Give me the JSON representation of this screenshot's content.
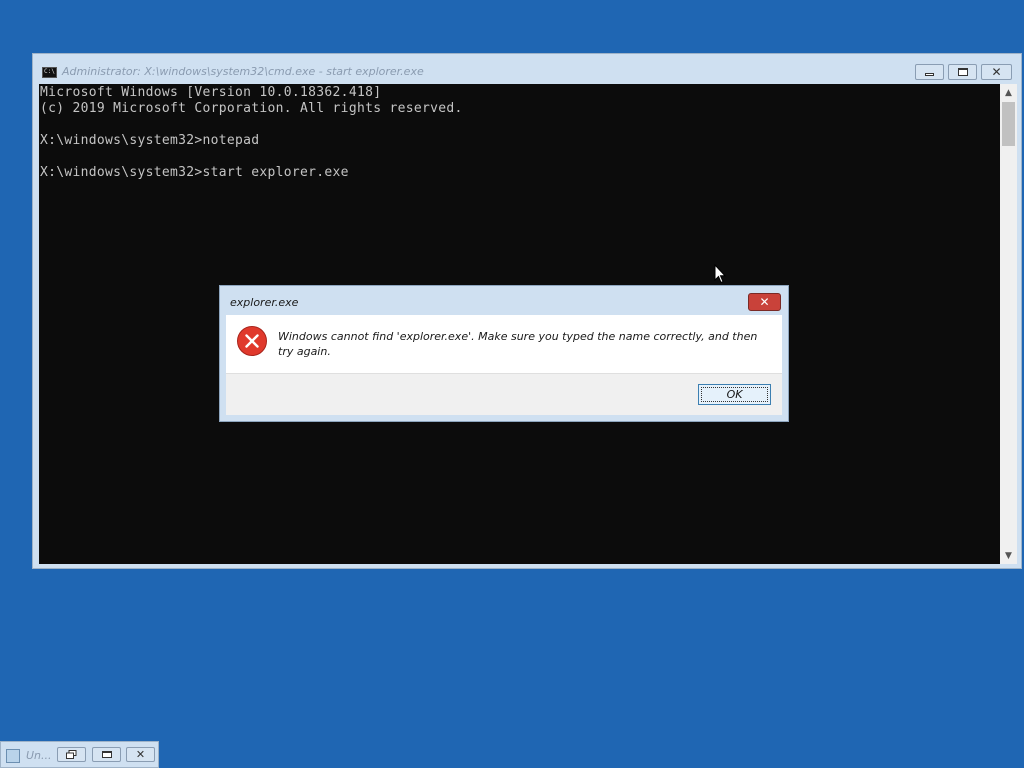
{
  "cmd_window": {
    "title": "Administrator: X:\\windows\\system32\\cmd.exe - start  explorer.exe",
    "icon": "console-app-icon",
    "icon_text": "C:\\",
    "buttons": {
      "minimize_icon": "minimize-icon",
      "maximize_icon": "maximize-icon",
      "close_icon": "close-icon",
      "close_glyph": "✕"
    },
    "console_lines": [
      "Microsoft Windows [Version 10.0.18362.418]",
      "(c) 2019 Microsoft Corporation. All rights reserved.",
      "",
      "X:\\windows\\system32>notepad",
      "",
      "X:\\windows\\system32>start explorer.exe"
    ],
    "scroll_up_glyph": "▲",
    "scroll_down_glyph": "▼"
  },
  "dialog": {
    "title": "explorer.exe",
    "close_glyph": "✕",
    "icon": "error-icon",
    "message": "Windows cannot find 'explorer.exe'. Make sure you typed the name correctly, and then try again.",
    "ok_label": "OK"
  },
  "minimized_window": {
    "title": "Un...",
    "close_glyph": "✕"
  },
  "colors": {
    "desktop": "#1f66b3",
    "console_bg": "#0c0c0c",
    "console_text": "#c4c4c4",
    "error_red": "#e0392c",
    "close_button_red": "#c9423a"
  }
}
